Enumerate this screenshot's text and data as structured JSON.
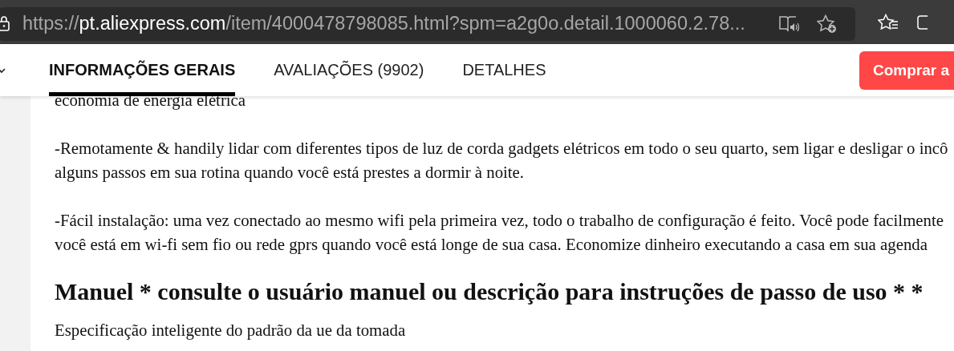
{
  "address_bar": {
    "url_host_prefix": "https://",
    "url_host": "pt.aliexpress.com",
    "url_path": "/item/4000478798085.html?spm=a2g0o.detail.1000060.2.78..."
  },
  "nav": {
    "tabs": [
      {
        "label": "INFORMAÇÕES GERAIS",
        "selected": true
      },
      {
        "label": "AVALIAÇÕES (9902)",
        "selected": false
      },
      {
        "label": "DETALHES",
        "selected": false
      }
    ],
    "buy_button": "Comprar a"
  },
  "content": [
    {
      "kind": "paragraph",
      "lines": [
        "economia de energia elétrica"
      ]
    },
    {
      "kind": "paragraph",
      "lines": [
        "-Remotamente & handily lidar com diferentes tipos de luz de corda gadgets elétricos em todo o seu quarto, sem ligar e desligar o incô",
        "alguns passos em sua rotina quando você está prestes a dormir à noite."
      ]
    },
    {
      "kind": "paragraph",
      "lines": [
        "-Fácil instalação: uma vez conectado ao mesmo wifi pela primeira vez, todo o trabalho de configuração é feito. Você pode facilmente",
        "você está em wi-fi sem fio ou rede gprs quando você está longe de sua casa. Economize dinheiro executando a casa em sua agenda"
      ]
    },
    {
      "kind": "heading",
      "lines": [
        "Manuel * consulte o usuário manuel ou descrição para instruções de passo de uso * *"
      ]
    },
    {
      "kind": "paragraph",
      "lines": [
        "Especificação inteligente do padrão da ue da tomada"
      ]
    }
  ]
}
